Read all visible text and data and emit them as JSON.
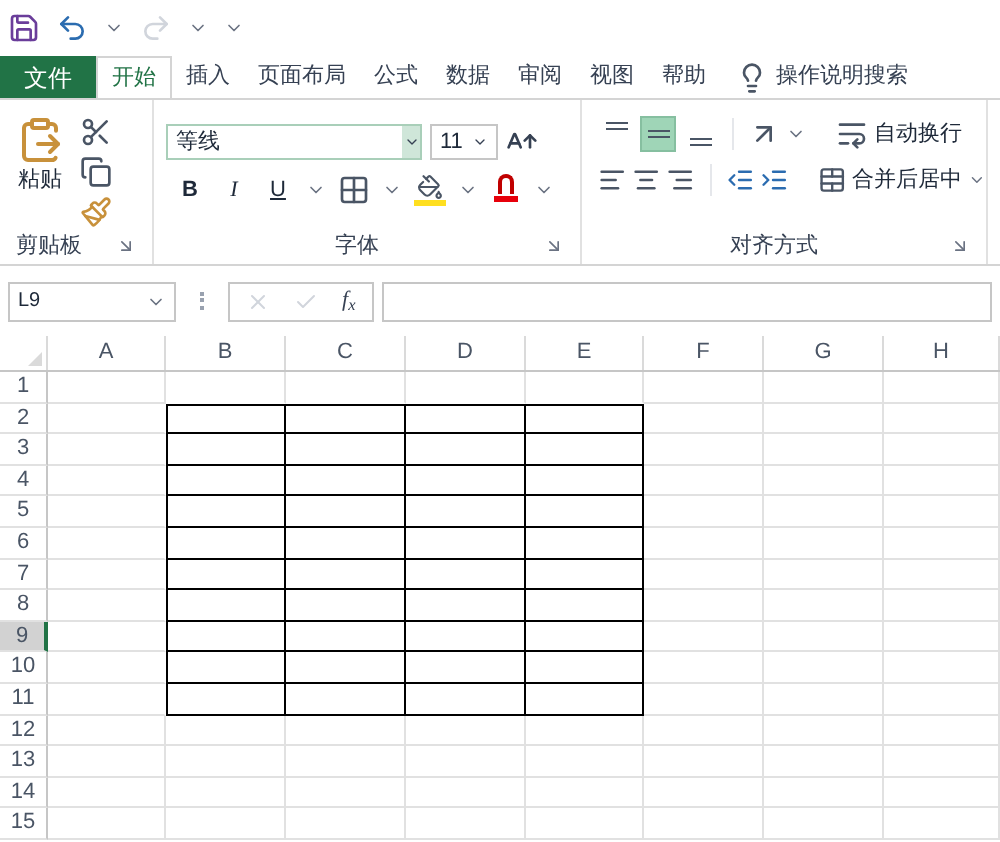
{
  "tabs": [
    {
      "label": "文件",
      "kind": "file",
      "selected": false
    },
    {
      "label": "开始",
      "kind": "tab",
      "selected": true
    },
    {
      "label": "插入",
      "kind": "tab",
      "selected": false
    },
    {
      "label": "页面布局",
      "kind": "tab",
      "selected": false
    },
    {
      "label": "公式",
      "kind": "tab",
      "selected": false
    },
    {
      "label": "数据",
      "kind": "tab",
      "selected": false
    },
    {
      "label": "审阅",
      "kind": "tab",
      "selected": false
    },
    {
      "label": "视图",
      "kind": "tab",
      "selected": false
    },
    {
      "label": "帮助",
      "kind": "tab",
      "selected": false
    }
  ],
  "tell_me": {
    "label": "操作说明搜索"
  },
  "ribbon": {
    "clipboard": {
      "paste": "粘贴",
      "group_label": "剪贴板"
    },
    "font": {
      "font_name": "等线",
      "font_size": "11",
      "bold": "B",
      "italic": "I",
      "underline": "U",
      "group_label": "字体"
    },
    "alignment": {
      "vertical": [
        {
          "selected": false
        },
        {
          "selected": true
        },
        {
          "selected": false
        }
      ],
      "wrap_text": "自动换行",
      "merge_center": "合并后居中",
      "group_label": "对齐方式"
    }
  },
  "formula_bar": {
    "name_box": "L9",
    "insert_function": "f$_{x}$"
  },
  "sheet": {
    "columns": [
      {
        "label": "A"
      },
      {
        "label": "B"
      },
      {
        "label": "C"
      },
      {
        "label": "D"
      },
      {
        "label": "E"
      },
      {
        "label": "F"
      },
      {
        "label": "G"
      },
      {
        "label": "H"
      }
    ],
    "rows": [
      {
        "label": "1",
        "selected": false,
        "bordered": [
          false,
          false,
          false,
          false,
          false,
          false,
          false,
          false
        ]
      },
      {
        "label": "2",
        "selected": false,
        "bordered": [
          false,
          true,
          true,
          true,
          true,
          false,
          false,
          false
        ]
      },
      {
        "label": "3",
        "selected": false,
        "bordered": [
          false,
          true,
          true,
          true,
          true,
          false,
          false,
          false
        ]
      },
      {
        "label": "4",
        "selected": false,
        "bordered": [
          false,
          true,
          true,
          true,
          true,
          false,
          false,
          false
        ]
      },
      {
        "label": "5",
        "selected": false,
        "bordered": [
          false,
          true,
          true,
          true,
          true,
          false,
          false,
          false
        ]
      },
      {
        "label": "6",
        "selected": false,
        "bordered": [
          false,
          true,
          true,
          true,
          true,
          false,
          false,
          false
        ]
      },
      {
        "label": "7",
        "selected": false,
        "bordered": [
          false,
          true,
          true,
          true,
          true,
          false,
          false,
          false
        ]
      },
      {
        "label": "8",
        "selected": false,
        "bordered": [
          false,
          true,
          true,
          true,
          true,
          false,
          false,
          false
        ]
      },
      {
        "label": "9",
        "selected": true,
        "bordered": [
          false,
          true,
          true,
          true,
          true,
          false,
          false,
          false
        ]
      },
      {
        "label": "10",
        "selected": false,
        "bordered": [
          false,
          true,
          true,
          true,
          true,
          false,
          false,
          false
        ]
      },
      {
        "label": "11",
        "selected": false,
        "bordered": [
          false,
          true,
          true,
          true,
          true,
          false,
          false,
          false
        ]
      },
      {
        "label": "12",
        "selected": false,
        "bordered": [
          false,
          false,
          false,
          false,
          false,
          false,
          false,
          false
        ]
      },
      {
        "label": "13",
        "selected": false,
        "bordered": [
          false,
          false,
          false,
          false,
          false,
          false,
          false,
          false
        ]
      },
      {
        "label": "14",
        "selected": false,
        "bordered": [
          false,
          false,
          false,
          false,
          false,
          false,
          false,
          false
        ]
      },
      {
        "label": "15",
        "selected": false,
        "bordered": [
          false,
          false,
          false,
          false,
          false,
          false,
          false,
          false
        ]
      }
    ]
  }
}
